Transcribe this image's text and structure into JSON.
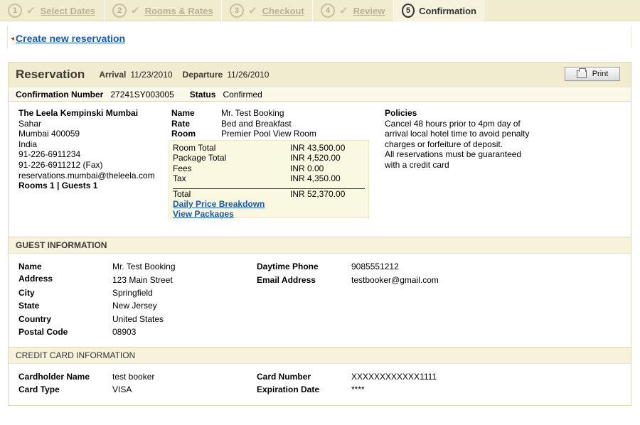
{
  "steps": [
    {
      "num": "1",
      "label": "Select Dates"
    },
    {
      "num": "2",
      "label": "Rooms & Rates"
    },
    {
      "num": "3",
      "label": "Checkout"
    },
    {
      "num": "4",
      "label": "Review"
    },
    {
      "num": "5",
      "label": "Confirmation"
    }
  ],
  "back_link": "Create new reservation",
  "reservation": {
    "title": "Reservation",
    "arrival_label": "Arrival",
    "arrival": "11/23/2010",
    "departure_label": "Departure",
    "departure": "11/26/2010",
    "print_label": "Print",
    "confirmation_label": "Confirmation Number",
    "confirmation_number": "27241SY003005",
    "status_label": "Status",
    "status": "Confirmed"
  },
  "hotel": {
    "name": "The Leela Kempinski Mumbai",
    "line1": "Sahar",
    "line2": "Mumbai 400059",
    "line3": "India",
    "phone": "91-226-6911234",
    "fax": "91-226-6911212 (Fax)",
    "email": "reservations.mumbai@theleela.com",
    "rooms_guests": "Rooms 1 | Guests 1"
  },
  "booking": {
    "name_label": "Name",
    "name": "Mr. Test Booking",
    "rate_label": "Rate",
    "rate": "Bed and Breakfast",
    "room_label": "Room",
    "room": "Premier Pool View Room"
  },
  "prices": {
    "room_total_label": "Room Total",
    "room_total": "INR 43,500.00",
    "package_total_label": "Package Total",
    "package_total": "INR 4,520.00",
    "fees_label": "Fees",
    "fees": "INR 0.00",
    "tax_label": "Tax",
    "tax": "INR 4,350.00",
    "total_label": "Total",
    "total": "INR 52,370.00",
    "daily_link": "Daily Price Breakdown",
    "packages_link": "View Packages"
  },
  "policies": {
    "title": "Policies",
    "l1": "Cancel 48 hours prior to 4pm day of",
    "l2": "arrival local hotel time to avoid penalty",
    "l3": "charges or forfeiture of deposit.",
    "l4": "All reservations must be guaranteed",
    "l5": "with a credit card"
  },
  "guest": {
    "section_title": "GUEST INFORMATION",
    "name_label": "Name",
    "name": "Mr. Test Booking",
    "address_label": "Address",
    "address": "123 Main Street",
    "city_label": "City",
    "city": "Springfield",
    "state_label": "State",
    "state": "New Jersey",
    "country_label": "Country",
    "country": "United States",
    "postal_label": "Postal Code",
    "postal": "08903",
    "phone_label": "Daytime Phone",
    "phone": "9085551212",
    "email_label": "Email Address",
    "email": "testbooker@gmail.com"
  },
  "card": {
    "section_title": "CREDIT CARD INFORMATION",
    "holder_label": "Cardholder Name",
    "holder": "test booker",
    "type_label": "Card Type",
    "type": "VISA",
    "number_label": "Card Number",
    "number": "XXXXXXXXXXXX1111",
    "exp_label": "Expiration Date",
    "exp": "****"
  }
}
